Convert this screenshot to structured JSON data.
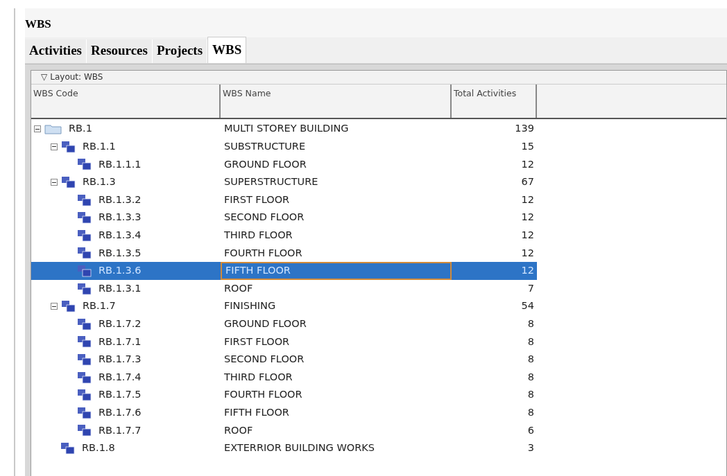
{
  "window": {
    "title": "WBS"
  },
  "tabs": [
    {
      "label": "Activities",
      "selected": false
    },
    {
      "label": "Resources",
      "selected": false
    },
    {
      "label": "Projects",
      "selected": false
    },
    {
      "label": "WBS",
      "selected": true
    }
  ],
  "layout": {
    "toggle": "▽",
    "label": "Layout: WBS"
  },
  "table": {
    "columns": [
      "WBS Code",
      "WBS Name",
      "Total Activities"
    ],
    "rows": [
      {
        "code": "RB.1",
        "name": "MULTI STOREY BUILDING",
        "total": "139",
        "kind": "folder",
        "expanded": true,
        "selected": false,
        "children": [
          {
            "code": "RB.1.1",
            "name": "SUBSTRUCTURE",
            "total": "15",
            "kind": "wbs",
            "expanded": true,
            "selected": false,
            "children": [
              {
                "code": "RB.1.1.1",
                "name": "GROUND FLOOR",
                "total": "12",
                "kind": "wbs",
                "selected": false
              }
            ]
          },
          {
            "code": "RB.1.3",
            "name": "SUPERSTRUCTURE",
            "total": "67",
            "kind": "wbs",
            "expanded": true,
            "selected": false,
            "children": [
              {
                "code": "RB.1.3.2",
                "name": "FIRST FLOOR",
                "total": "12",
                "kind": "wbs",
                "selected": false
              },
              {
                "code": "RB.1.3.3",
                "name": "SECOND FLOOR",
                "total": "12",
                "kind": "wbs",
                "selected": false
              },
              {
                "code": "RB.1.3.4",
                "name": "THIRD FLOOR",
                "total": "12",
                "kind": "wbs",
                "selected": false
              },
              {
                "code": "RB.1.3.5",
                "name": "FOURTH FLOOR",
                "total": "12",
                "kind": "wbs",
                "selected": false
              },
              {
                "code": "RB.1.3.6",
                "name": "FIFTH FLOOR",
                "total": "12",
                "kind": "wbs",
                "selected": true
              },
              {
                "code": "RB.1.3.1",
                "name": "ROOF",
                "total": "7",
                "kind": "wbs",
                "selected": false
              }
            ]
          },
          {
            "code": "RB.1.7",
            "name": "FINISHING",
            "total": "54",
            "kind": "wbs",
            "expanded": true,
            "selected": false,
            "children": [
              {
                "code": "RB.1.7.2",
                "name": "GROUND FLOOR",
                "total": "8",
                "kind": "wbs",
                "selected": false
              },
              {
                "code": "RB.1.7.1",
                "name": "FIRST FLOOR",
                "total": "8",
                "kind": "wbs",
                "selected": false
              },
              {
                "code": "RB.1.7.3",
                "name": "SECOND FLOOR",
                "total": "8",
                "kind": "wbs",
                "selected": false
              },
              {
                "code": "RB.1.7.4",
                "name": "THIRD FLOOR",
                "total": "8",
                "kind": "wbs",
                "selected": false
              },
              {
                "code": "RB.1.7.5",
                "name": "FOURTH FLOOR",
                "total": "8",
                "kind": "wbs",
                "selected": false
              },
              {
                "code": "RB.1.7.6",
                "name": "FIFTH FLOOR",
                "total": "8",
                "kind": "wbs",
                "selected": false
              },
              {
                "code": "RB.1.7.7",
                "name": "ROOF",
                "total": "6",
                "kind": "wbs",
                "selected": false
              }
            ]
          },
          {
            "code": "RB.1.8",
            "name": "EXTERRIOR BUILDING WORKS",
            "total": "3",
            "kind": "wbs",
            "selected": false
          }
        ]
      }
    ]
  }
}
